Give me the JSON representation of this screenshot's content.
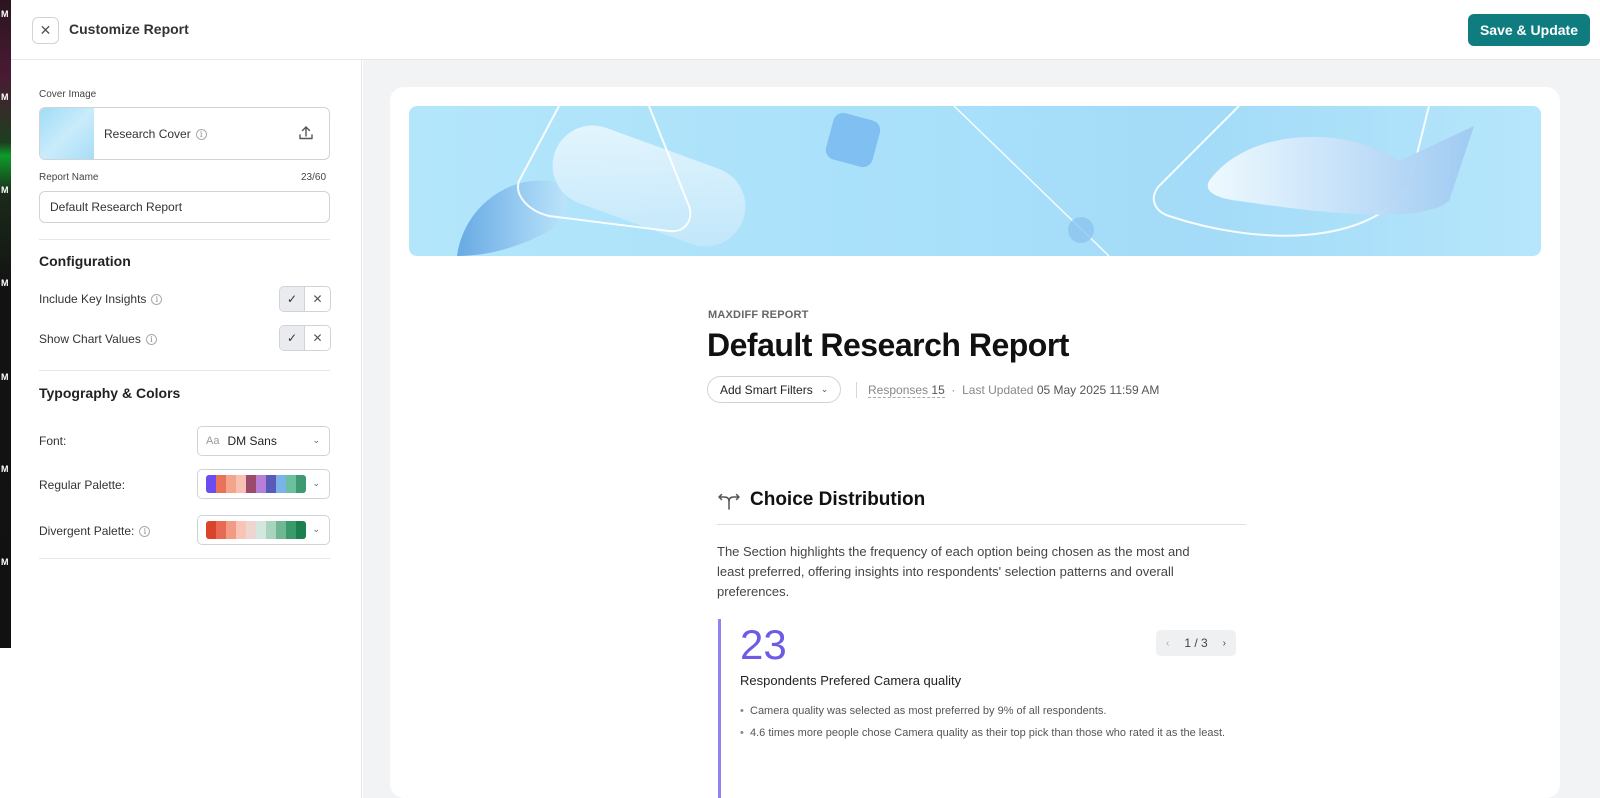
{
  "header": {
    "close_icon": "close-icon",
    "title": "Customize Report",
    "save_label": "Save & Update"
  },
  "sidebar": {
    "cover": {
      "label": "Cover Image",
      "name": "Research Cover",
      "info_glyph": "i",
      "upload_icon": "upload-icon"
    },
    "report_name": {
      "label": "Report Name",
      "counter": "23/60",
      "value": "Default Research Report"
    },
    "configuration": {
      "title": "Configuration",
      "items": [
        {
          "label": "Include Key Insights",
          "value": true
        },
        {
          "label": "Show Chart Values",
          "value": true
        }
      ]
    },
    "typography": {
      "title": "Typography & Colors",
      "font_label": "Font:",
      "font_prefix": "Aa",
      "font_value": "DM Sans",
      "regular_label": "Regular Palette:",
      "regular_colors": [
        "#6a4cf0",
        "#e8735a",
        "#f3a58c",
        "#f6c1b2",
        "#9c4a6c",
        "#b77fd6",
        "#5a5ab8",
        "#7bb3e8",
        "#6cc0a0",
        "#3f9a72"
      ],
      "divergent_label": "Divergent Palette:",
      "divergent_colors": [
        "#d9442b",
        "#e86a52",
        "#f29a84",
        "#f7c4b6",
        "#eed6d0",
        "#d5e6df",
        "#a8d3bd",
        "#6fb792",
        "#3a9a69",
        "#1b7f4e"
      ]
    }
  },
  "edge_strip": [
    "M",
    "M",
    "M",
    "M",
    "M",
    "M",
    "M"
  ],
  "report": {
    "kicker": "MAXDIFF REPORT",
    "title": "Default Research Report",
    "filters_label": "Add Smart Filters",
    "responses_label": "Responses",
    "responses_count": "15",
    "separator": "·",
    "updated_label": "Last Updated",
    "updated_value": "05 May 2025 11:59 AM",
    "section": {
      "icon": "split-arrows-icon",
      "title": "Choice Distribution",
      "description": "The Section highlights the frequency of each option being chosen as the most and least preferred, offering insights into respondents' selection patterns and overall preferences."
    },
    "insight": {
      "number": "23",
      "caption": "Respondents Prefered Camera quality",
      "page": "1 / 3",
      "bullets": [
        "Camera quality was selected as most preferred by 9% of all respondents.",
        "4.6 times more people chose Camera quality as their top pick than those who rated it as the least."
      ]
    }
  }
}
